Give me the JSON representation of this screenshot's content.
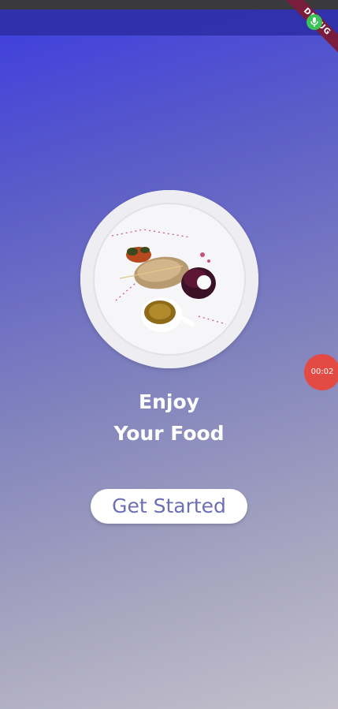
{
  "status_bar": {
    "debug_banner_label": "DEBUG",
    "mic_icon": "microphone-icon"
  },
  "hero": {
    "image": "food-plate-image",
    "headline_line1": "Enjoy",
    "headline_line2": "Your Food"
  },
  "actions": {
    "get_started_label": "Get Started"
  },
  "screen_recorder": {
    "timer": "00:02"
  },
  "colors": {
    "gradient_start": "#3b3be0",
    "gradient_end": "#c2bfcb",
    "button_text": "#6c6fb4",
    "recorder_bubble": "#e34a44",
    "debug_banner": "#7a1d3c",
    "mic_indicator": "#3cc25a"
  }
}
